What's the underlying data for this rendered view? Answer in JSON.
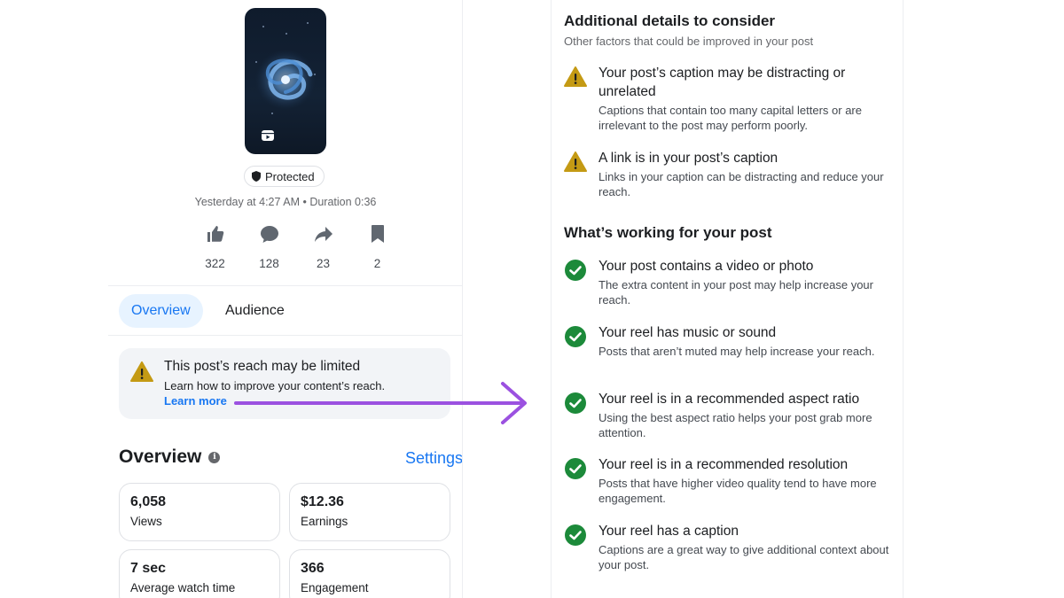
{
  "post": {
    "protected_label": "Protected",
    "meta": "Yesterday at 4:27 AM • Duration 0:36",
    "stats": [
      {
        "icon": "like-icon",
        "value": "322"
      },
      {
        "icon": "comment-icon",
        "value": "128"
      },
      {
        "icon": "share-icon",
        "value": "23"
      },
      {
        "icon": "bookmark-icon",
        "value": "2"
      }
    ]
  },
  "tabs": {
    "overview": "Overview",
    "audience": "Audience"
  },
  "alert": {
    "title": "This post’s reach may be limited",
    "subtitle": "Learn how to improve your content’s reach.",
    "link": "Learn more"
  },
  "overview": {
    "heading": "Overview",
    "info_glyph": "i",
    "settings": "Settings",
    "cards": [
      {
        "value": "6,058",
        "label": "Views"
      },
      {
        "value": "$12.36",
        "label": "Earnings"
      },
      {
        "value": "7 sec",
        "label": "Average watch time"
      },
      {
        "value": "366",
        "label": "Engagement"
      }
    ]
  },
  "details": {
    "title": "Additional details to consider",
    "subtitle": "Other factors that could be improved in your post",
    "items": [
      {
        "title": "Your post’s caption may be distracting or unrelated",
        "desc": "Captions that contain too many capital letters or are irrelevant to the post may perform poorly."
      },
      {
        "title": "A link is in your post’s caption",
        "desc": "Links in your caption can be distracting and reduce your reach."
      }
    ]
  },
  "working": {
    "title": "What’s working for your post",
    "items": [
      {
        "title": "Your post contains a video or photo",
        "desc": "The extra content in your post may help increase your reach."
      },
      {
        "title": "Your reel has music or sound",
        "desc": "Posts that aren’t muted may help increase your reach."
      },
      {
        "title": "Your reel is in a recommended aspect ratio",
        "desc": "Using the best aspect ratio helps your post grab more attention."
      },
      {
        "title": "Your reel is in a recommended resolution",
        "desc": "Posts that have higher video quality tend to have more engagement."
      },
      {
        "title": "Your reel has a caption",
        "desc": "Captions are a great way to give additional context about your post."
      }
    ]
  },
  "colors": {
    "accent": "#1877f2",
    "warning": "#c49a14",
    "success": "#1c8a3a",
    "arrow": "#9b51e0"
  }
}
